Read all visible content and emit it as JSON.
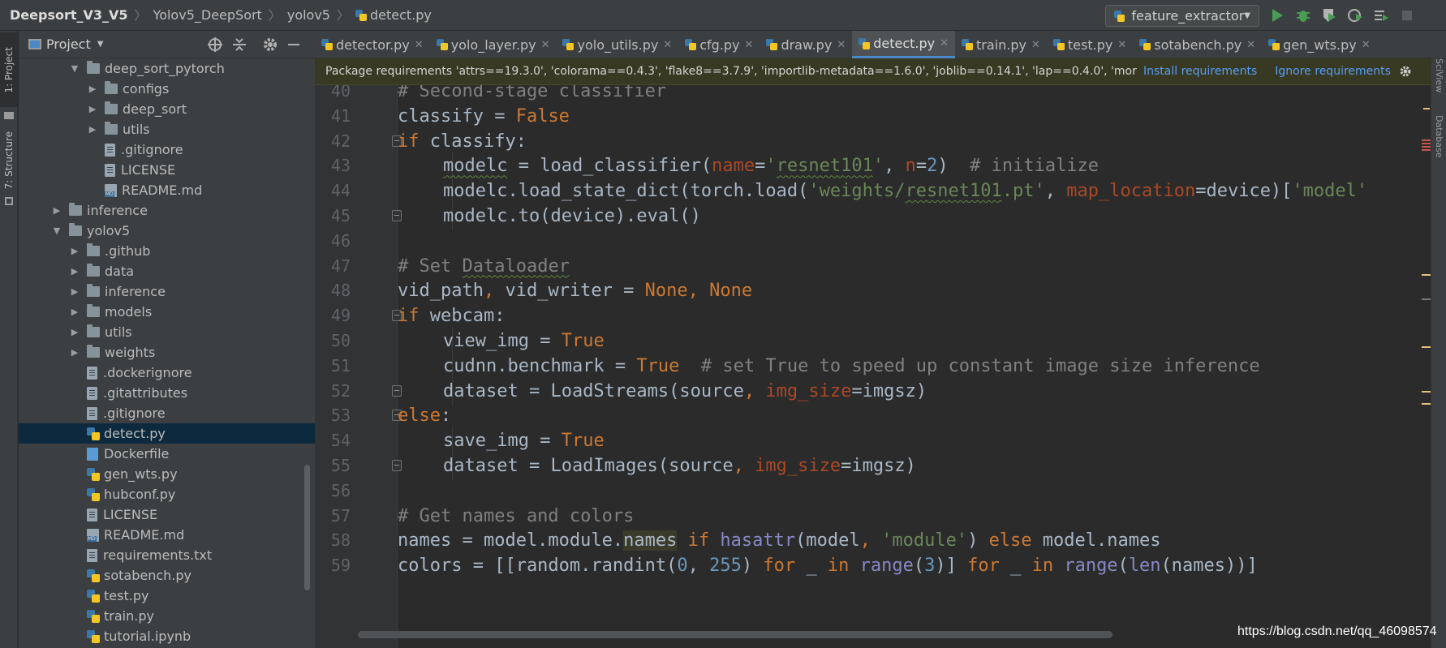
{
  "breadcrumb": {
    "items": [
      "Deepsort_V3_V5",
      "Yolov5_DeepSort",
      "yolov5",
      "detect.py"
    ]
  },
  "toolbar": {
    "run_config": "feature_extractor",
    "icons": [
      "run-icon",
      "debug-icon",
      "coverage-icon",
      "profile-icon",
      "run-config-icon",
      "stop-icon"
    ]
  },
  "left_strip": {
    "project_tab": "1: Project",
    "structure_tab": "7: Structure"
  },
  "right_strip": {
    "sview_tab": "SciView",
    "database_tab": "Database"
  },
  "project_panel": {
    "title": "Project",
    "tree": [
      {
        "label": "deep_sort_pytorch",
        "type": "folder",
        "depth": 2,
        "expanded": true
      },
      {
        "label": "configs",
        "type": "folder",
        "depth": 3
      },
      {
        "label": "deep_sort",
        "type": "folder",
        "depth": 3
      },
      {
        "label": "utils",
        "type": "folder",
        "depth": 3
      },
      {
        "label": ".gitignore",
        "type": "file",
        "depth": 3
      },
      {
        "label": "LICENSE",
        "type": "file",
        "depth": 3
      },
      {
        "label": "README.md",
        "type": "md",
        "depth": 3
      },
      {
        "label": "inference",
        "type": "folder",
        "depth": 1
      },
      {
        "label": "yolov5",
        "type": "folder",
        "depth": 1,
        "expanded": true
      },
      {
        "label": ".github",
        "type": "folder",
        "depth": 2
      },
      {
        "label": "data",
        "type": "folder",
        "depth": 2
      },
      {
        "label": "inference",
        "type": "folder",
        "depth": 2
      },
      {
        "label": "models",
        "type": "folder",
        "depth": 2
      },
      {
        "label": "utils",
        "type": "folder",
        "depth": 2
      },
      {
        "label": "weights",
        "type": "folder",
        "depth": 2
      },
      {
        "label": ".dockerignore",
        "type": "file",
        "depth": 2
      },
      {
        "label": ".gitattributes",
        "type": "file",
        "depth": 2
      },
      {
        "label": ".gitignore",
        "type": "file",
        "depth": 2
      },
      {
        "label": "detect.py",
        "type": "py",
        "depth": 2,
        "selected": true
      },
      {
        "label": "Dockerfile",
        "type": "docker",
        "depth": 2
      },
      {
        "label": "gen_wts.py",
        "type": "py",
        "depth": 2
      },
      {
        "label": "hubconf.py",
        "type": "py",
        "depth": 2
      },
      {
        "label": "LICENSE",
        "type": "file",
        "depth": 2
      },
      {
        "label": "README.md",
        "type": "md",
        "depth": 2
      },
      {
        "label": "requirements.txt",
        "type": "file",
        "depth": 2
      },
      {
        "label": "sotabench.py",
        "type": "py",
        "depth": 2
      },
      {
        "label": "test.py",
        "type": "py",
        "depth": 2
      },
      {
        "label": "train.py",
        "type": "py",
        "depth": 2
      },
      {
        "label": "tutorial.ipynb",
        "type": "py",
        "depth": 2
      }
    ]
  },
  "tabs": [
    {
      "label": "detector.py"
    },
    {
      "label": "yolo_layer.py"
    },
    {
      "label": "yolo_utils.py"
    },
    {
      "label": "cfg.py"
    },
    {
      "label": "draw.py"
    },
    {
      "label": "detect.py",
      "active": true
    },
    {
      "label": "train.py"
    },
    {
      "label": "test.py"
    },
    {
      "label": "sotabench.py"
    },
    {
      "label": "gen_wts.py"
    }
  ],
  "banner": {
    "message": "Package requirements 'attrs==19.3.0', 'colorama==0.4.3', 'flake8==3.7.9', 'importlib-metadata==1.6.0', 'joblib==0.14.1', 'lap==0.4.0', 'mor",
    "install": "Install requirements",
    "ignore": "Ignore requirements"
  },
  "editor": {
    "lines": [
      {
        "n": "40",
        "indent": 1,
        "tokens": [
          {
            "t": "# Second-stage classifier",
            "c": "cm"
          }
        ]
      },
      {
        "n": "41",
        "indent": 1,
        "tokens": [
          {
            "t": "classify = "
          },
          {
            "t": "False",
            "c": "kw"
          }
        ]
      },
      {
        "n": "42",
        "indent": 1,
        "fold": true,
        "tokens": [
          {
            "t": "if ",
            "c": "kw"
          },
          {
            "t": "classify:"
          }
        ]
      },
      {
        "n": "43",
        "indent": 2,
        "tokens": [
          {
            "t": "modelc",
            "c": "squig"
          },
          {
            "t": " = load_classifier("
          },
          {
            "t": "name",
            "c": "pm"
          },
          {
            "t": "="
          },
          {
            "t": "'",
            "c": "st"
          },
          {
            "t": "resnet101",
            "c": "st squig"
          },
          {
            "t": "'",
            "c": "st"
          },
          {
            "t": ", "
          },
          {
            "t": "n",
            "c": "pm"
          },
          {
            "t": "="
          },
          {
            "t": "2",
            "c": "nm"
          },
          {
            "t": ")  "
          },
          {
            "t": "# initialize",
            "c": "cm"
          }
        ]
      },
      {
        "n": "44",
        "indent": 2,
        "tokens": [
          {
            "t": "modelc.load_state_dict(torch.load("
          },
          {
            "t": "'weights/",
            "c": "st"
          },
          {
            "t": "resnet101",
            "c": "st squig"
          },
          {
            "t": ".pt'",
            "c": "st"
          },
          {
            "t": ", "
          },
          {
            "t": "map_location",
            "c": "pm"
          },
          {
            "t": "=device)["
          },
          {
            "t": "'model'",
            "c": "st"
          }
        ]
      },
      {
        "n": "45",
        "indent": 2,
        "fold": true,
        "tokens": [
          {
            "t": "modelc.to(device).eval()"
          }
        ]
      },
      {
        "n": "46",
        "indent": 0,
        "tokens": []
      },
      {
        "n": "47",
        "indent": 1,
        "tokens": [
          {
            "t": "# Set ",
            "c": "cm"
          },
          {
            "t": "Dataloader",
            "c": "cm squig"
          }
        ]
      },
      {
        "n": "48",
        "indent": 1,
        "tokens": [
          {
            "t": "vid_path"
          },
          {
            "t": ", ",
            "c": "kw"
          },
          {
            "t": "vid_writer = "
          },
          {
            "t": "None",
            "c": "kw"
          },
          {
            "t": ", ",
            "c": "kw"
          },
          {
            "t": "None",
            "c": "kw"
          }
        ]
      },
      {
        "n": "49",
        "indent": 1,
        "fold": true,
        "tokens": [
          {
            "t": "if ",
            "c": "kw"
          },
          {
            "t": "webcam:"
          }
        ]
      },
      {
        "n": "50",
        "indent": 2,
        "tokens": [
          {
            "t": "view_img = "
          },
          {
            "t": "True",
            "c": "kw"
          }
        ]
      },
      {
        "n": "51",
        "indent": 2,
        "tokens": [
          {
            "t": "cudnn.benchmark = "
          },
          {
            "t": "True",
            "c": "kw"
          },
          {
            "t": "  "
          },
          {
            "t": "# set True to speed up constant image size inference",
            "c": "cm"
          }
        ]
      },
      {
        "n": "52",
        "indent": 2,
        "fold": true,
        "tokens": [
          {
            "t": "dataset = LoadStreams(source"
          },
          {
            "t": ", ",
            "c": "kw"
          },
          {
            "t": "img_size",
            "c": "pm"
          },
          {
            "t": "=imgsz)"
          }
        ]
      },
      {
        "n": "53",
        "indent": 1,
        "fold": true,
        "tokens": [
          {
            "t": "else",
            "c": "kw"
          },
          {
            "t": ":"
          }
        ]
      },
      {
        "n": "54",
        "indent": 2,
        "tokens": [
          {
            "t": "save_img = "
          },
          {
            "t": "True",
            "c": "kw"
          }
        ]
      },
      {
        "n": "55",
        "indent": 2,
        "fold": true,
        "tokens": [
          {
            "t": "dataset = LoadImages(source"
          },
          {
            "t": ", ",
            "c": "kw"
          },
          {
            "t": "img_size",
            "c": "pm"
          },
          {
            "t": "=imgsz)"
          }
        ]
      },
      {
        "n": "56",
        "indent": 0,
        "tokens": []
      },
      {
        "n": "57",
        "indent": 1,
        "tokens": [
          {
            "t": "# Get names and colors",
            "c": "cm"
          }
        ]
      },
      {
        "n": "58",
        "indent": 1,
        "tokens": [
          {
            "t": "names = model.module."
          },
          {
            "t": "names",
            "c": "hl"
          },
          {
            "t": " "
          },
          {
            "t": "if ",
            "c": "kw"
          },
          {
            "t": "hasattr",
            "c": "bi"
          },
          {
            "t": "(model"
          },
          {
            "t": ", ",
            "c": "kw"
          },
          {
            "t": "'module'",
            "c": "st"
          },
          {
            "t": ") "
          },
          {
            "t": "else ",
            "c": "kw"
          },
          {
            "t": "model.names"
          }
        ]
      },
      {
        "n": "59",
        "indent": 1,
        "tokens": [
          {
            "t": "colors = [[random.randint("
          },
          {
            "t": "0",
            "c": "nm"
          },
          {
            "t": ", "
          },
          {
            "t": "255",
            "c": "nm"
          },
          {
            "t": ") "
          },
          {
            "t": "for ",
            "c": "kw"
          },
          {
            "t": "_ "
          },
          {
            "t": "in ",
            "c": "kw"
          },
          {
            "t": "range",
            "c": "bi"
          },
          {
            "t": "("
          },
          {
            "t": "3",
            "c": "nm"
          },
          {
            "t": ")] "
          },
          {
            "t": "for ",
            "c": "kw"
          },
          {
            "t": "_ "
          },
          {
            "t": "in ",
            "c": "kw"
          },
          {
            "t": "range",
            "c": "bi"
          },
          {
            "t": "("
          },
          {
            "t": "len",
            "c": "bi"
          },
          {
            "t": "(names))]"
          }
        ]
      }
    ]
  },
  "watermark": "https://blog.csdn.net/qq_46098574",
  "colors": {
    "accent": "#4a88c7",
    "selection": "#0d293e",
    "banner_bg": "#383922"
  }
}
